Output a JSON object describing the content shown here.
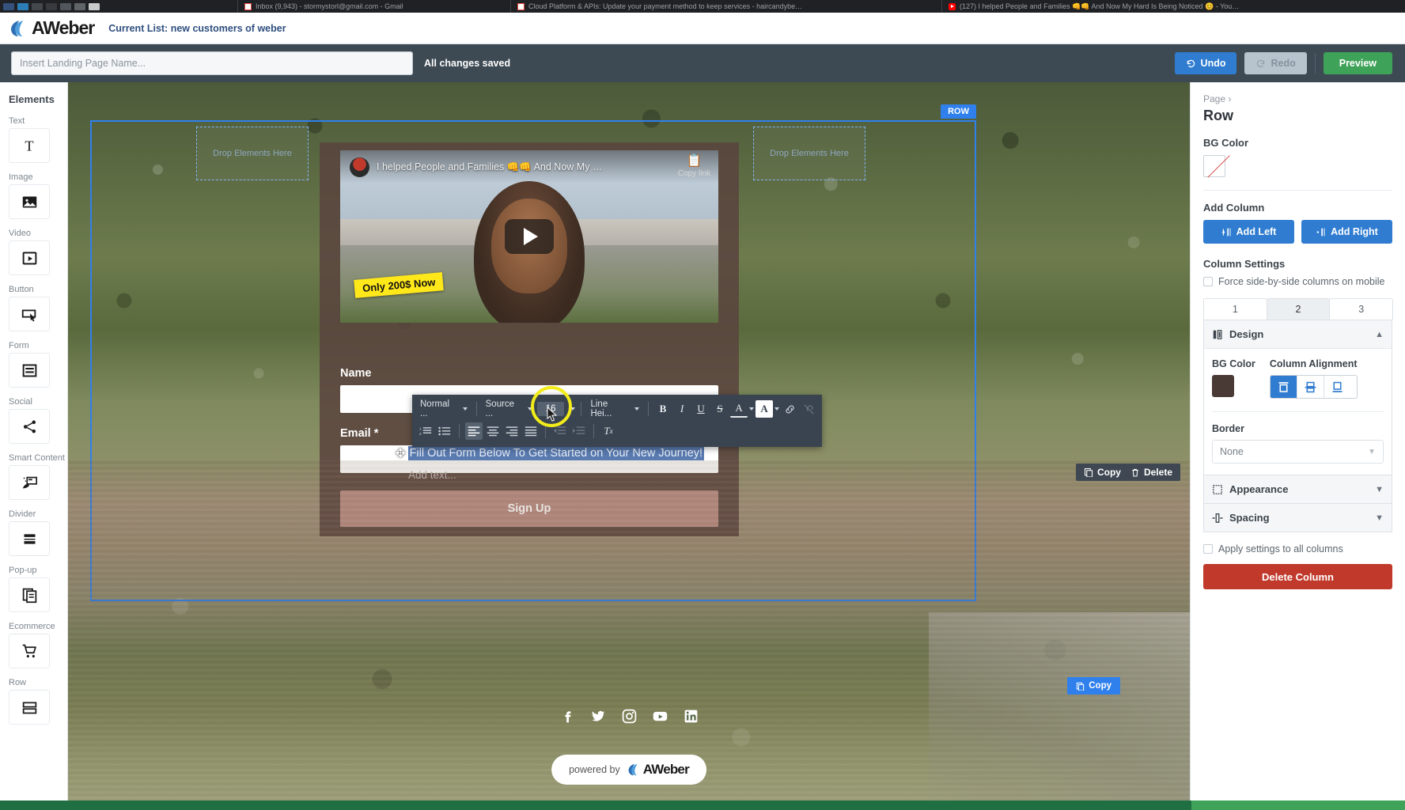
{
  "browser": {
    "tabs": [
      {
        "title": "Inbox (9,943) - stormystorl@gmail.com - Gmail",
        "favicon": "gmail-icon"
      },
      {
        "title": "Cloud Platform & APIs: Update your payment method to keep services - haircandybe…",
        "favicon": "gmail-icon"
      },
      {
        "title": "(127) I helped People and Families 👊👊 And Now My Hard Is Being Noticed 😊 - You…",
        "favicon": "youtube-icon"
      }
    ]
  },
  "header": {
    "logo_text": "AWeber",
    "current_list": "Current List: new customers of weber"
  },
  "toolbar": {
    "page_name_placeholder": "Insert Landing Page Name...",
    "page_name_value": "",
    "save_status": "All changes saved",
    "undo_label": "Undo",
    "redo_label": "Redo",
    "preview_label": "Preview"
  },
  "elements_panel": {
    "title": "Elements",
    "items": [
      {
        "label": "Text",
        "icon": "text-icon"
      },
      {
        "label": "Image",
        "icon": "image-icon"
      },
      {
        "label": "Video",
        "icon": "video-icon"
      },
      {
        "label": "Button",
        "icon": "button-icon"
      },
      {
        "label": "Form",
        "icon": "form-icon"
      },
      {
        "label": "Social",
        "icon": "share-icon"
      },
      {
        "label": "Smart Content",
        "icon": "smart-content-icon"
      },
      {
        "label": "Divider",
        "icon": "divider-icon"
      },
      {
        "label": "Pop-up",
        "icon": "popup-icon"
      },
      {
        "label": "Ecommerce",
        "icon": "cart-icon"
      },
      {
        "label": "Row",
        "icon": "row-icon"
      }
    ]
  },
  "canvas": {
    "row_badge": "ROW",
    "drop_left": "Drop Elements Here",
    "drop_right": "Drop Elements Here",
    "video": {
      "title": "I helped People and Families 👊👊 And Now My …",
      "copy_link_label": "Copy link",
      "overlay_tag": "Only 200$ Now"
    },
    "headline": "Fill Out Form Below To Get Started on Your New Journey!",
    "add_text_placeholder": "Add text...",
    "element_actions": {
      "copy": "Copy",
      "delete": "Delete"
    },
    "form": {
      "name_label": "Name",
      "name_value": "",
      "email_label": "Email *",
      "email_value": "",
      "submit_label": "Sign Up"
    },
    "copy_row_label": "Copy",
    "social_icons": [
      "facebook-icon",
      "twitter-icon",
      "instagram-icon",
      "youtube-icon",
      "linkedin-icon"
    ],
    "footer": {
      "powered_by": "powered by",
      "brand": "AWeber"
    }
  },
  "rte": {
    "format_label": "Normal ...",
    "source_label": "Source ...",
    "font_size": "16",
    "line_height_label": "Line Hei...",
    "bold": "B",
    "italic": "I",
    "underline": "U",
    "strike": "S",
    "text_color": "A",
    "bg_color": "A",
    "link": "link-icon",
    "unlink": "unlink-icon",
    "ordered_list": "ordered-list-icon",
    "bullet_list": "bullet-list-icon",
    "align_left": "align-left-icon",
    "align_center": "align-center-icon",
    "align_right": "align-right-icon",
    "align_justify": "align-justify-icon",
    "indent_less": "indent-decrease-icon",
    "indent_more": "indent-increase-icon",
    "clear_format": "clear-format-icon"
  },
  "right_panel": {
    "breadcrumb": "Page ›",
    "title": "Row",
    "bg_color_label": "BG Color",
    "bg_color_value": "none",
    "add_column_label": "Add Column",
    "add_left_label": "Add Left",
    "add_right_label": "Add Right",
    "column_settings_label": "Column Settings",
    "force_side_by_side_label": "Force side-by-side columns on mobile",
    "force_side_by_side_checked": false,
    "column_tabs": [
      "1",
      "2",
      "3"
    ],
    "active_column_tab": "2",
    "design": {
      "section_label": "Design",
      "expanded": true,
      "bg_color_label": "BG Color",
      "bg_color_value": "#4a3a36",
      "column_alignment_label": "Column Alignment",
      "alignment_options": [
        "align-top-icon",
        "align-middle-icon",
        "align-bottom-icon"
      ],
      "alignment_selected": "align-top-icon",
      "border_label": "Border",
      "border_value": "None"
    },
    "appearance_label": "Appearance",
    "spacing_label": "Spacing",
    "apply_all_label": "Apply settings to all columns",
    "apply_all_checked": false,
    "delete_column_label": "Delete Column",
    "accent_blue": "#2f7cd1",
    "danger_red": "#c0392b"
  }
}
